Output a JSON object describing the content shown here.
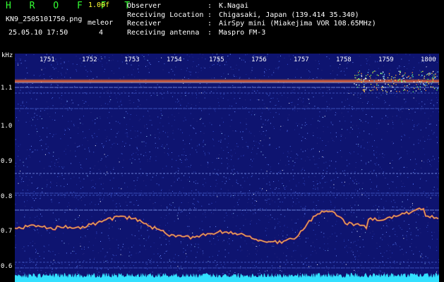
{
  "header": {
    "app_title": "HROFFT",
    "version": "1.00f",
    "filename": "KN9_2505101750.png",
    "datetime": "25.05.10 17:50",
    "mode_label": "meleor",
    "mode_count": "4"
  },
  "station": [
    {
      "key": "Observer",
      "sep": ":",
      "value": "K.Nagai"
    },
    {
      "key": "Receiving Location",
      "sep": ":",
      "value": "Chigasaki, Japan (139.414 35.340)"
    },
    {
      "key": "Receiver",
      "sep": ":",
      "value": "AirSpy mini (Miakejima VOR 108.65MHz)"
    },
    {
      "key": "Receiving antenna",
      "sep": ":",
      "value": "Maspro FM-3"
    }
  ],
  "axis": {
    "y_unit": "kHz",
    "y_ticks": [
      "1.1",
      "1.0",
      "0.9",
      "0.8",
      "0.7",
      "0.6"
    ],
    "x_ticks": [
      "1751",
      "1752",
      "1753",
      "1754",
      "1755",
      "1756",
      "1757",
      "1758",
      "1759",
      "1800"
    ]
  },
  "colors": {
    "background": "#0e1470",
    "title": "#33ff33",
    "version": "#ffff33",
    "carrier": "#ff6a2a",
    "trace": "#ff7a5a",
    "noise_floor": "#33e0ff"
  }
}
